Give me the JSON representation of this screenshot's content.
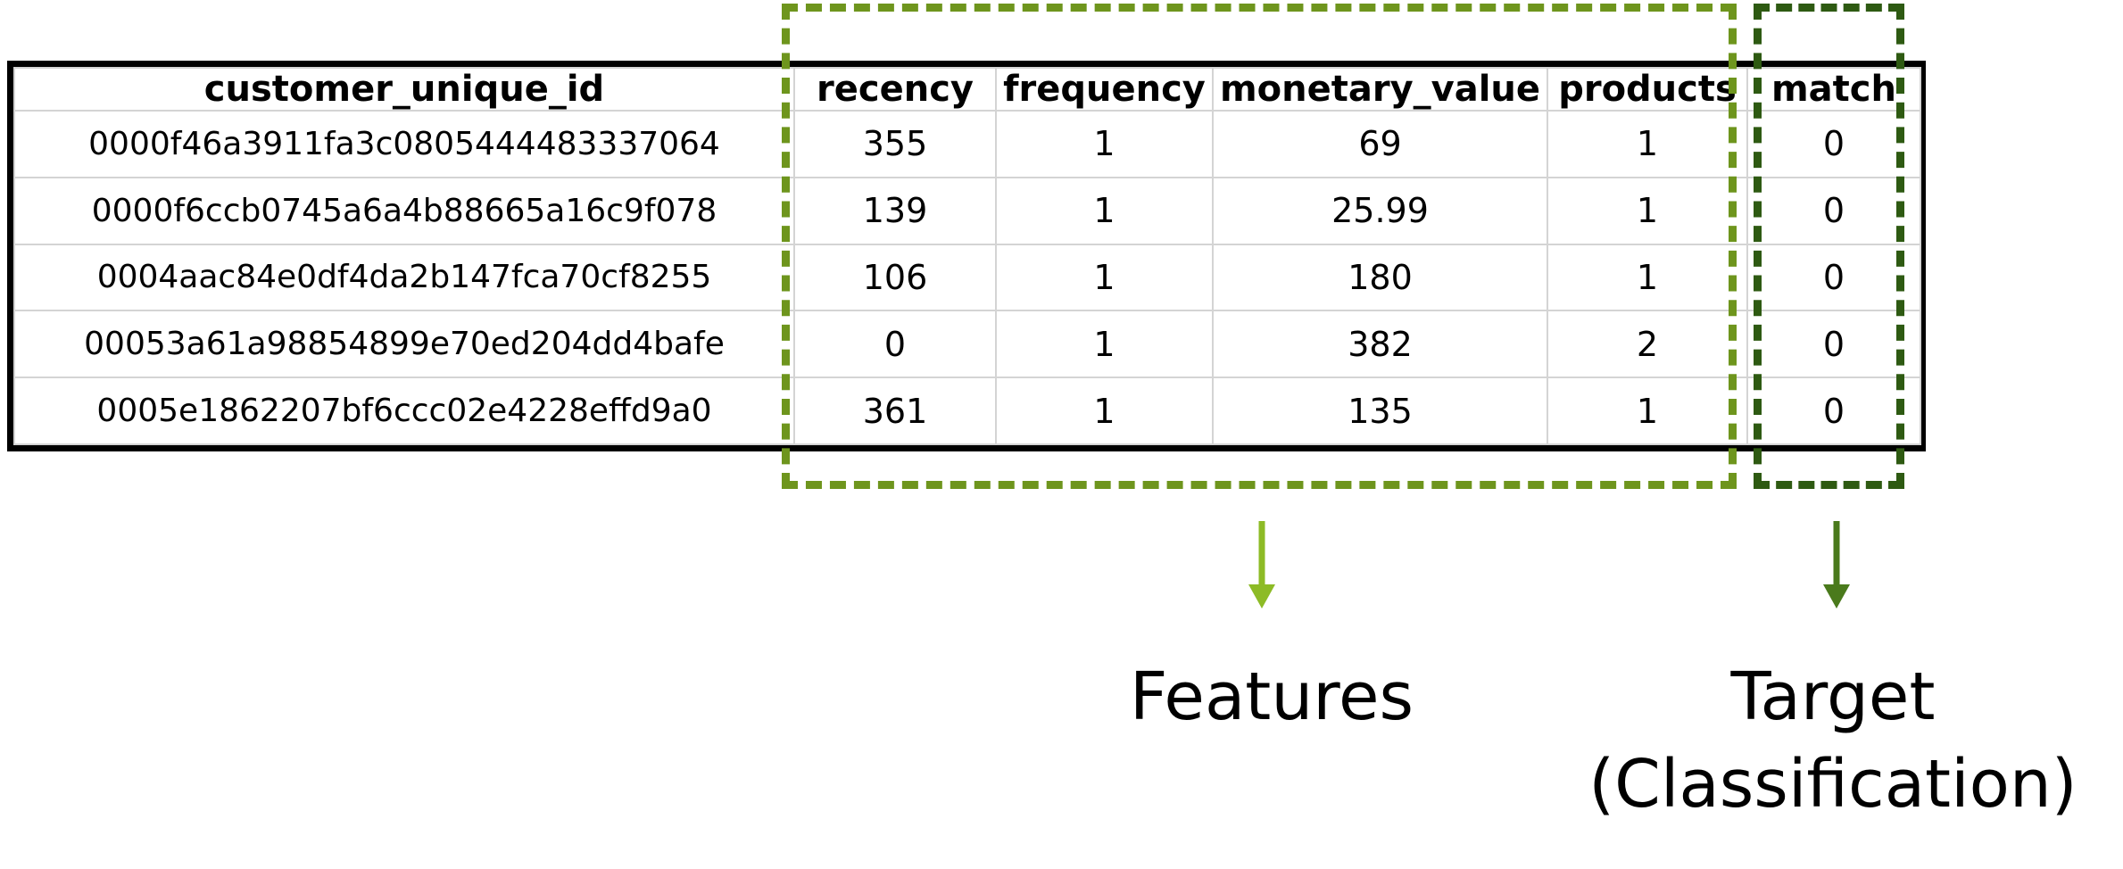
{
  "table": {
    "columns": [
      "customer_unique_id",
      "recency",
      "frequency",
      "monetary_value",
      "products",
      "match"
    ],
    "rows": [
      [
        "0000f46a3911fa3c0805444483337064",
        "355",
        "1",
        "69",
        "1",
        "0"
      ],
      [
        "0000f6ccb0745a6a4b88665a16c9f078",
        "139",
        "1",
        "25.99",
        "1",
        "0"
      ],
      [
        "0004aac84e0df4da2b147fca70cf8255",
        "106",
        "1",
        "180",
        "1",
        "0"
      ],
      [
        "00053a61a98854899e70ed204dd4bafe",
        "0",
        "1",
        "382",
        "2",
        "0"
      ],
      [
        "0005e1862207bf6ccc02e4228effd9a0",
        "361",
        "1",
        "135",
        "1",
        "0"
      ]
    ]
  },
  "labels": {
    "features": "Features",
    "target_line1": "Target",
    "target_line2": "(Classification)"
  },
  "colors": {
    "features_accent": "#6e951d",
    "features_arrow": "#8dbb26",
    "target_accent": "#2e5a12",
    "target_arrow": "#4a7a1c",
    "table_border": "#000000",
    "grid_line": "#d4d4d4"
  }
}
